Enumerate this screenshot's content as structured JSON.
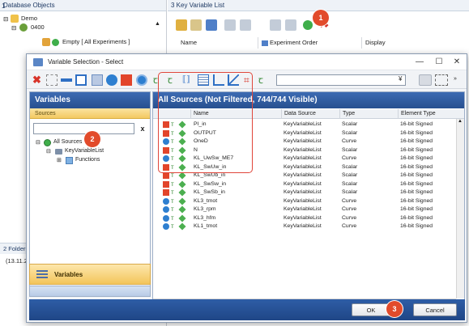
{
  "background": {
    "db_objects_title": "Database Objects",
    "tree": {
      "demo": "Demo",
      "node_0400": "0400",
      "empty_all": "Empty [ All Experiments ]"
    },
    "folder_label": "Folder",
    "folder_value": "(13.11.2",
    "kvl_title": "Key Variable List",
    "kvl_columns": [
      "Name",
      "Experiment Order",
      "Display"
    ]
  },
  "dialog": {
    "title": "Variable Selection - Select",
    "minimize": "—",
    "maximize": "☐",
    "close": "✕",
    "variables_header": "Variables",
    "sources_label": "Sources",
    "clear_label": "x",
    "source_tree": {
      "all_sources": "All Sources",
      "key_variable_list": "KeyVariableList",
      "functions": "Functions"
    },
    "footer_label": "Variables",
    "sources_header": "All Sources (Not Filtered, 744/744 Visible)",
    "grid_columns": [
      "Name",
      "Data Source",
      "Type",
      "Element Type"
    ],
    "rows": [
      {
        "name": "PI_in",
        "source": "KeyVariableList",
        "type": "Scalar",
        "element": "16-bit Signed",
        "kind": "scalar"
      },
      {
        "name": "OUTPUT",
        "source": "KeyVariableList",
        "type": "Scalar",
        "element": "16-bit Signed",
        "kind": "scalar"
      },
      {
        "name": "OneD",
        "source": "KeyVariableList",
        "type": "Curve",
        "element": "16-bit Signed",
        "kind": "curve"
      },
      {
        "name": "N",
        "source": "KeyVariableList",
        "type": "Scalar",
        "element": "16-bit Signed",
        "kind": "scalar"
      },
      {
        "name": "KL_UwSw_ME7",
        "source": "KeyVariableList",
        "type": "Curve",
        "element": "16-bit Signed",
        "kind": "curve"
      },
      {
        "name": "KL_SwUw_in",
        "source": "KeyVariableList",
        "type": "Scalar",
        "element": "16-bit Signed",
        "kind": "scalar"
      },
      {
        "name": "KL_SwUb_in",
        "source": "KeyVariableList",
        "type": "Scalar",
        "element": "16-bit Signed",
        "kind": "scalar"
      },
      {
        "name": "KL_SwSw_in",
        "source": "KeyVariableList",
        "type": "Scalar",
        "element": "16-bit Signed",
        "kind": "scalar"
      },
      {
        "name": "KL_SwSb_in",
        "source": "KeyVariableList",
        "type": "Scalar",
        "element": "16-bit Signed",
        "kind": "scalar"
      },
      {
        "name": "KL3_tmot",
        "source": "KeyVariableList",
        "type": "Curve",
        "element": "16-bit Signed",
        "kind": "curve"
      },
      {
        "name": "KL3_rpm",
        "source": "KeyVariableList",
        "type": "Curve",
        "element": "16-bit Signed",
        "kind": "curve"
      },
      {
        "name": "KL3_hfm",
        "source": "KeyVariableList",
        "type": "Curve",
        "element": "16-bit Signed",
        "kind": "curve"
      },
      {
        "name": "KL1_tmot",
        "source": "KeyVariableList",
        "type": "Curve",
        "element": "16-bit Signed",
        "kind": "curve"
      }
    ],
    "ok_label": "OK",
    "cancel_label": "Cancel"
  },
  "badges": [
    "1",
    "2",
    "3"
  ],
  "colors": {
    "header_blue": "#2f5c9e",
    "highlight_red": "#e0463a",
    "scalar_icon": "#e2452b",
    "curve_icon": "#2e7fd0",
    "sources_orange": "#f6d37a"
  }
}
